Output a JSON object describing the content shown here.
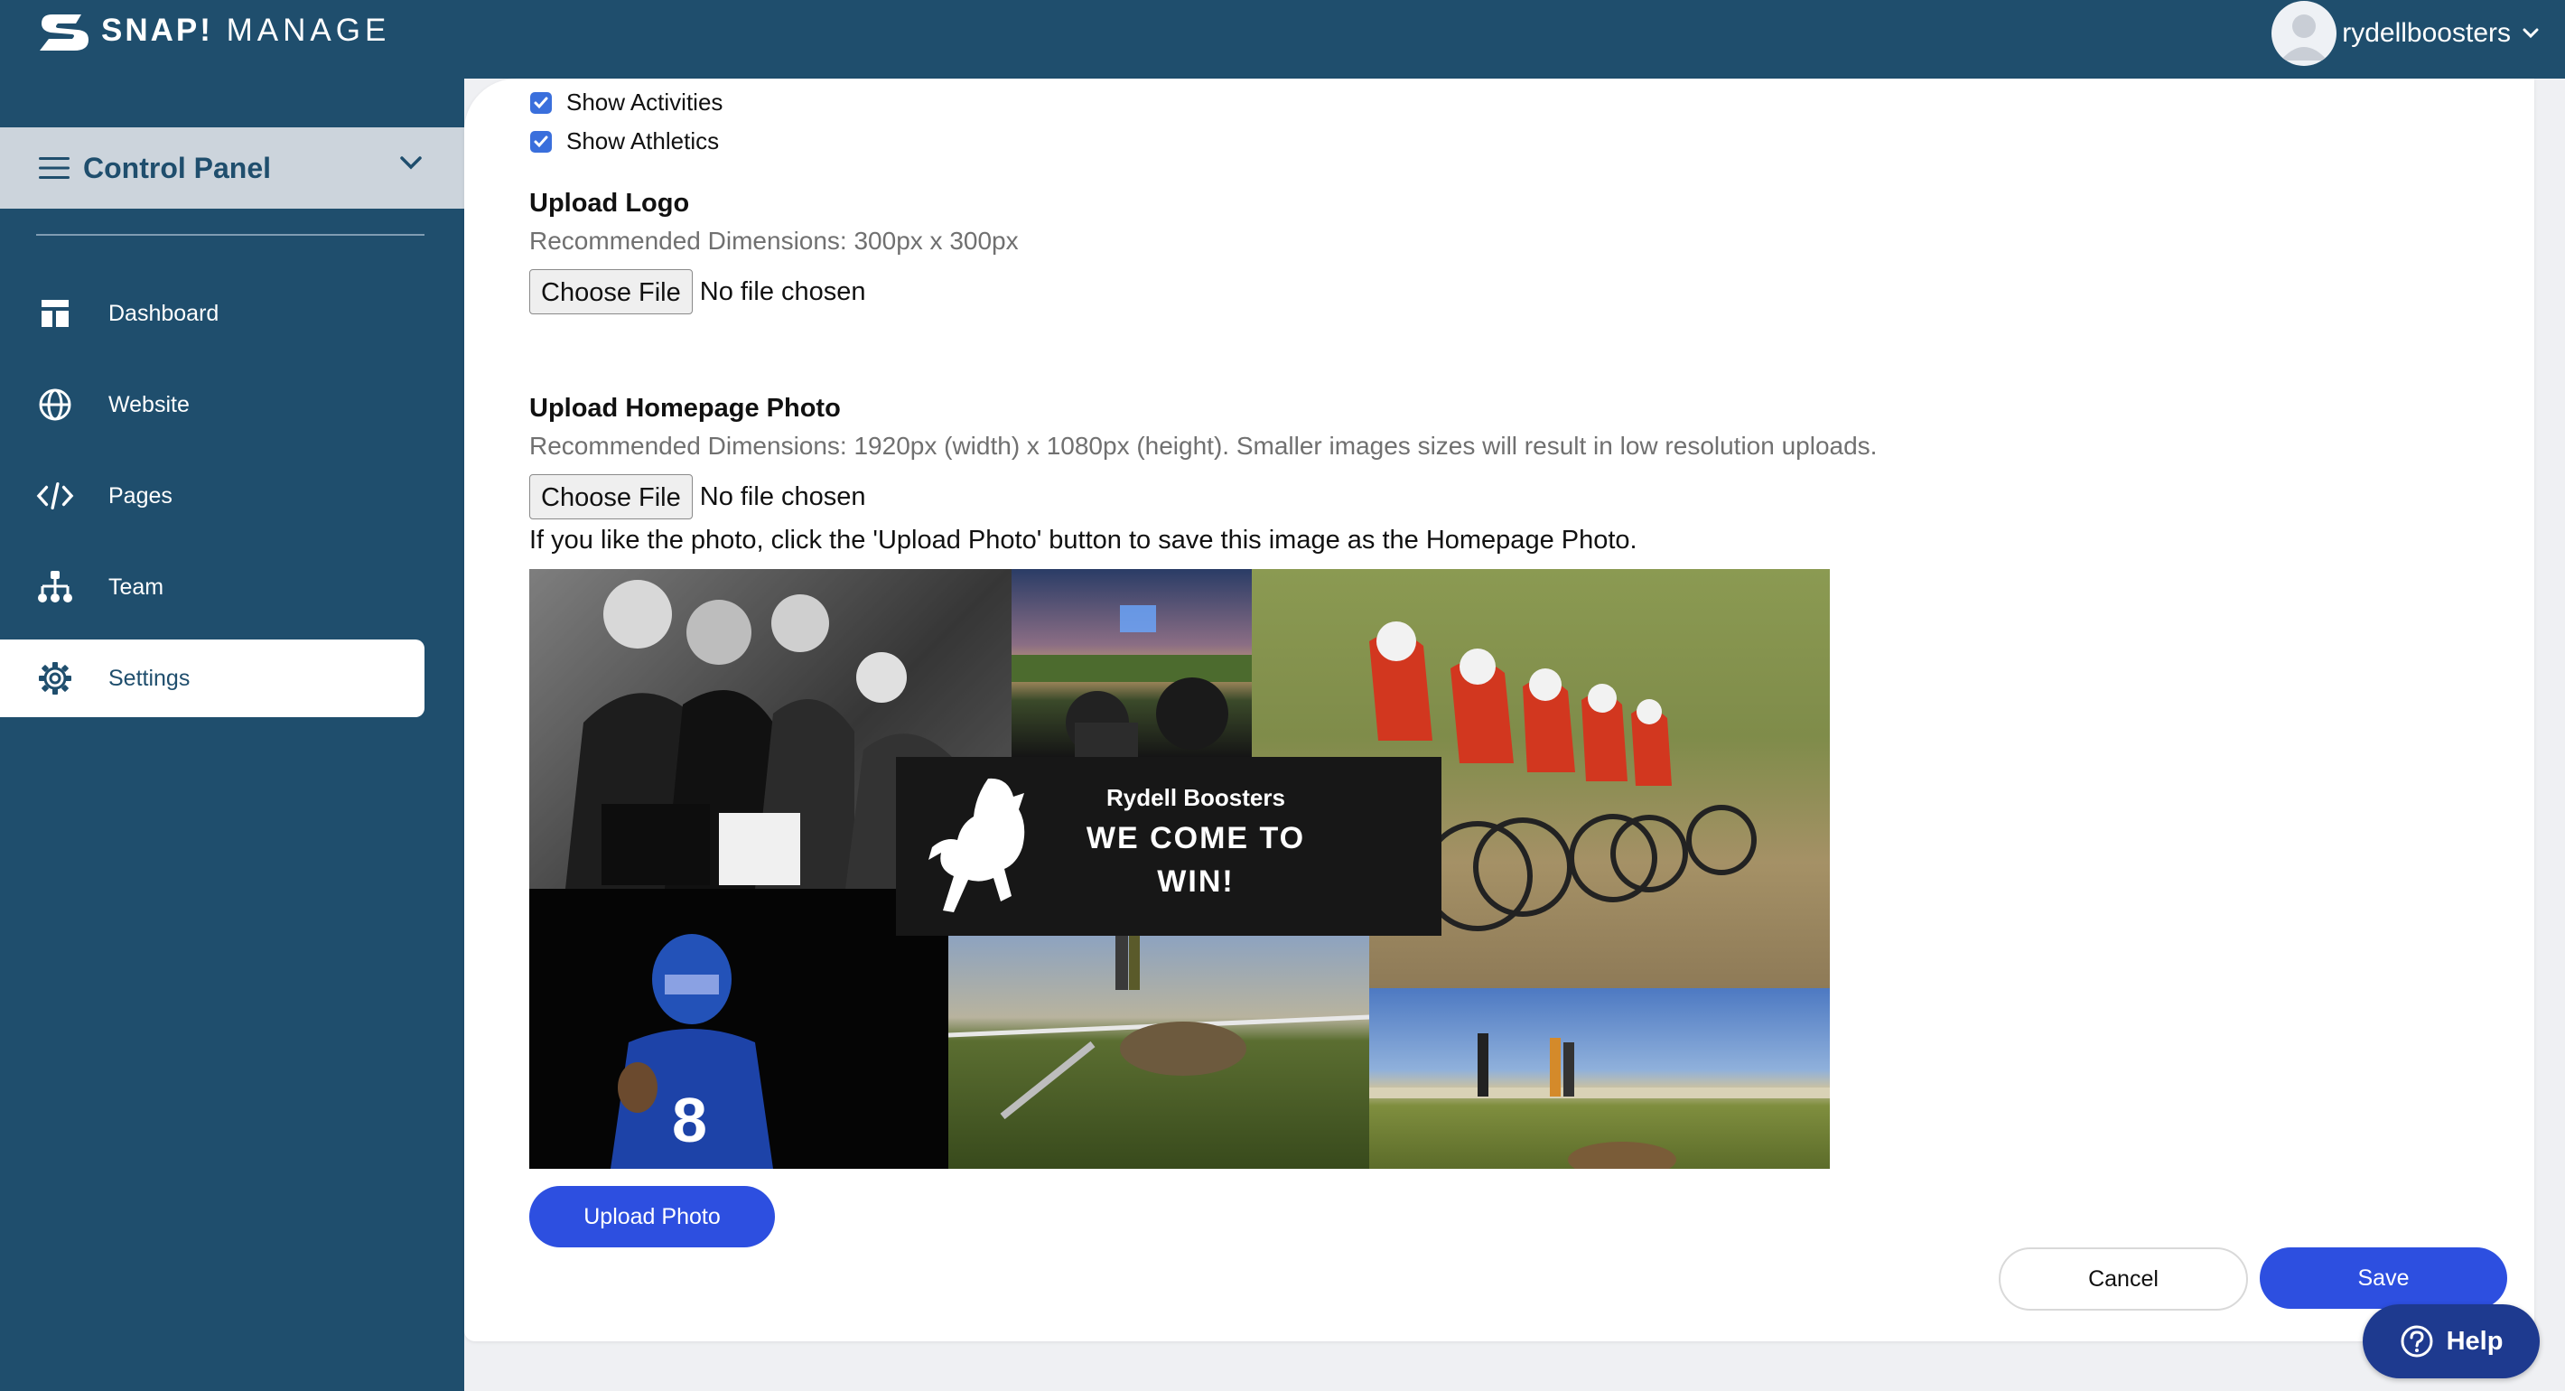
{
  "header": {
    "brand_strong": "SNAP!",
    "brand_rest": "MANAGE",
    "username": "rydellboosters"
  },
  "sidebar": {
    "control_panel_label": "Control Panel",
    "items": [
      {
        "label": "Dashboard",
        "icon": "dashboard-icon"
      },
      {
        "label": "Website",
        "icon": "globe-icon"
      },
      {
        "label": "Pages",
        "icon": "code-icon"
      },
      {
        "label": "Team",
        "icon": "team-icon"
      },
      {
        "label": "Settings",
        "icon": "gear-icon",
        "active": true
      }
    ]
  },
  "form": {
    "checkboxes": [
      {
        "label": "Show Activities",
        "checked": true
      },
      {
        "label": "Show Athletics",
        "checked": true
      }
    ],
    "logo": {
      "title": "Upload Logo",
      "hint": "Recommended Dimensions: 300px x 300px",
      "choose_label": "Choose File",
      "status": "No file chosen"
    },
    "homepage_photo": {
      "title": "Upload Homepage Photo",
      "hint": "Recommended Dimensions: 1920px (width) x 1080px (height). Smaller images sizes will result in low resolution uploads.",
      "choose_label": "Choose File",
      "status": "No file chosen",
      "note": "If you like the photo, click the 'Upload Photo' button to save this image as the Homepage Photo."
    },
    "banner": {
      "name": "Rydell Boosters",
      "tagline": "WE COME TO WIN!"
    },
    "upload_photo_label": "Upload Photo",
    "cancel_label": "Cancel",
    "save_label": "Save"
  },
  "help_label": "Help",
  "colors": {
    "navy": "#1f4e6d",
    "primary": "#2d4fe0",
    "help": "#1e3a8f",
    "checkbox": "#3a6fdc"
  }
}
